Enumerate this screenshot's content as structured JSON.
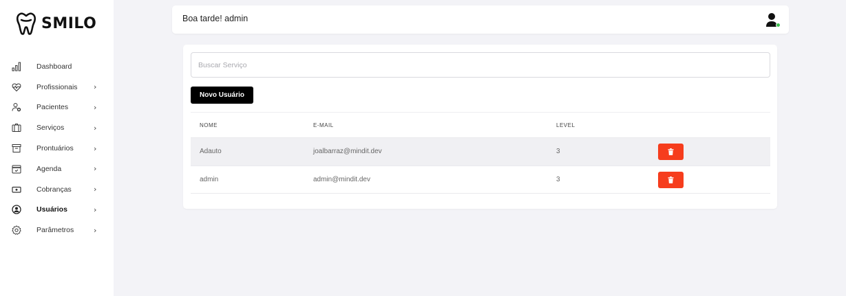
{
  "app": {
    "logo_text": "SMILO"
  },
  "sidebar": {
    "items": [
      {
        "label": "Dashboard",
        "icon": "bar-chart-icon",
        "has_chevron": false,
        "active": false
      },
      {
        "label": "Profissionais",
        "icon": "heart-pulse-icon",
        "has_chevron": true,
        "active": false
      },
      {
        "label": "Pacientes",
        "icon": "user-settings-icon",
        "has_chevron": true,
        "active": false
      },
      {
        "label": "Serviços",
        "icon": "briefcase-icon",
        "has_chevron": true,
        "active": false
      },
      {
        "label": "Prontuários",
        "icon": "archive-icon",
        "has_chevron": true,
        "active": false
      },
      {
        "label": "Agenda",
        "icon": "calendar-check-icon",
        "has_chevron": true,
        "active": false
      },
      {
        "label": "Cobranças",
        "icon": "money-icon",
        "has_chevron": true,
        "active": false
      },
      {
        "label": "Usuários",
        "icon": "user-circle-icon",
        "has_chevron": true,
        "active": true
      },
      {
        "label": "Parâmetros",
        "icon": "gear-icon",
        "has_chevron": true,
        "active": false
      }
    ],
    "chevron": "›"
  },
  "header": {
    "greeting": "Boa tarde! admin",
    "status_color": "#3ec04f"
  },
  "main": {
    "search": {
      "placeholder": "Buscar Serviço",
      "value": ""
    },
    "new_button_label": "Novo Usuário",
    "table": {
      "columns": [
        "NOME",
        "E-MAIL",
        "LEVEL"
      ],
      "rows": [
        {
          "nome": "Adauto",
          "email": "joalbarraz@mindit.dev",
          "level": "3"
        },
        {
          "nome": "admin",
          "email": "admin@mindit.dev",
          "level": "3"
        }
      ]
    },
    "delete_color": "#f63d1d"
  }
}
